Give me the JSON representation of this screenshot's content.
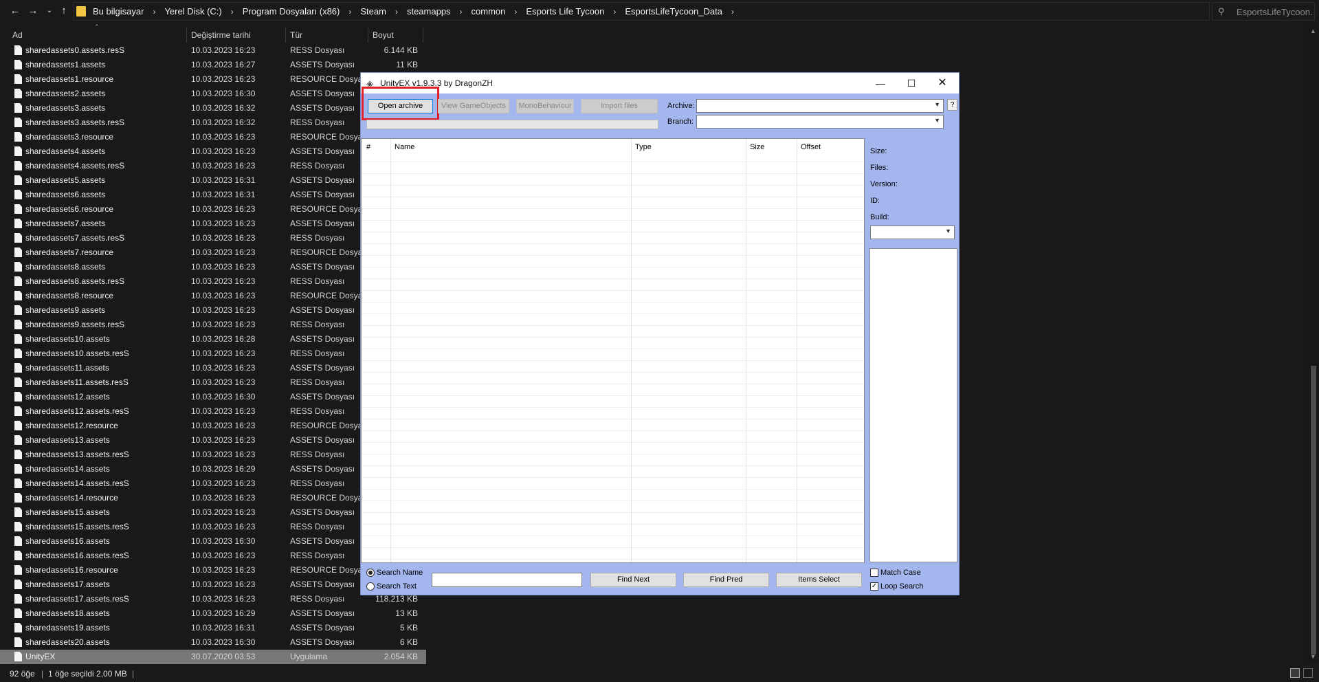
{
  "explorer": {
    "breadcrumbs": [
      "Bu bilgisayar",
      "Yerel Disk (C:)",
      "Program Dosyaları (x86)",
      "Steam",
      "steamapps",
      "common",
      "Esports Life Tycoon",
      "EsportsLifeTycoon_Data"
    ],
    "search_placeholder": "EsportsLifeTycoon...",
    "columns": {
      "name": "Ad",
      "date": "Değiştirme tarihi",
      "type": "Tür",
      "size": "Boyut"
    },
    "files": [
      {
        "name": "sharedassets0.assets.resS",
        "date": "10.03.2023 16:23",
        "type": "RESS Dosyası",
        "size": "6.144 KB"
      },
      {
        "name": "sharedassets1.assets",
        "date": "10.03.2023 16:27",
        "type": "ASSETS Dosyası",
        "size": "11 KB"
      },
      {
        "name": "sharedassets1.resource",
        "date": "10.03.2023 16:23",
        "type": "RESOURCE Dosyası",
        "size": ""
      },
      {
        "name": "sharedassets2.assets",
        "date": "10.03.2023 16:30",
        "type": "ASSETS Dosyası",
        "size": ""
      },
      {
        "name": "sharedassets3.assets",
        "date": "10.03.2023 16:32",
        "type": "ASSETS Dosyası",
        "size": ""
      },
      {
        "name": "sharedassets3.assets.resS",
        "date": "10.03.2023 16:32",
        "type": "RESS Dosyası",
        "size": ""
      },
      {
        "name": "sharedassets3.resource",
        "date": "10.03.2023 16:23",
        "type": "RESOURCE Dosyası",
        "size": ""
      },
      {
        "name": "sharedassets4.assets",
        "date": "10.03.2023 16:23",
        "type": "ASSETS Dosyası",
        "size": ""
      },
      {
        "name": "sharedassets4.assets.resS",
        "date": "10.03.2023 16:23",
        "type": "RESS Dosyası",
        "size": ""
      },
      {
        "name": "sharedassets5.assets",
        "date": "10.03.2023 16:31",
        "type": "ASSETS Dosyası",
        "size": ""
      },
      {
        "name": "sharedassets6.assets",
        "date": "10.03.2023 16:31",
        "type": "ASSETS Dosyası",
        "size": ""
      },
      {
        "name": "sharedassets6.resource",
        "date": "10.03.2023 16:23",
        "type": "RESOURCE Dosyası",
        "size": ""
      },
      {
        "name": "sharedassets7.assets",
        "date": "10.03.2023 16:23",
        "type": "ASSETS Dosyası",
        "size": ""
      },
      {
        "name": "sharedassets7.assets.resS",
        "date": "10.03.2023 16:23",
        "type": "RESS Dosyası",
        "size": ""
      },
      {
        "name": "sharedassets7.resource",
        "date": "10.03.2023 16:23",
        "type": "RESOURCE Dosyası",
        "size": ""
      },
      {
        "name": "sharedassets8.assets",
        "date": "10.03.2023 16:23",
        "type": "ASSETS Dosyası",
        "size": ""
      },
      {
        "name": "sharedassets8.assets.resS",
        "date": "10.03.2023 16:23",
        "type": "RESS Dosyası",
        "size": ""
      },
      {
        "name": "sharedassets8.resource",
        "date": "10.03.2023 16:23",
        "type": "RESOURCE Dosyası",
        "size": ""
      },
      {
        "name": "sharedassets9.assets",
        "date": "10.03.2023 16:23",
        "type": "ASSETS Dosyası",
        "size": ""
      },
      {
        "name": "sharedassets9.assets.resS",
        "date": "10.03.2023 16:23",
        "type": "RESS Dosyası",
        "size": ""
      },
      {
        "name": "sharedassets10.assets",
        "date": "10.03.2023 16:28",
        "type": "ASSETS Dosyası",
        "size": ""
      },
      {
        "name": "sharedassets10.assets.resS",
        "date": "10.03.2023 16:23",
        "type": "RESS Dosyası",
        "size": ""
      },
      {
        "name": "sharedassets11.assets",
        "date": "10.03.2023 16:23",
        "type": "ASSETS Dosyası",
        "size": ""
      },
      {
        "name": "sharedassets11.assets.resS",
        "date": "10.03.2023 16:23",
        "type": "RESS Dosyası",
        "size": ""
      },
      {
        "name": "sharedassets12.assets",
        "date": "10.03.2023 16:30",
        "type": "ASSETS Dosyası",
        "size": ""
      },
      {
        "name": "sharedassets12.assets.resS",
        "date": "10.03.2023 16:23",
        "type": "RESS Dosyası",
        "size": ""
      },
      {
        "name": "sharedassets12.resource",
        "date": "10.03.2023 16:23",
        "type": "RESOURCE Dosyası",
        "size": ""
      },
      {
        "name": "sharedassets13.assets",
        "date": "10.03.2023 16:23",
        "type": "ASSETS Dosyası",
        "size": ""
      },
      {
        "name": "sharedassets13.assets.resS",
        "date": "10.03.2023 16:23",
        "type": "RESS Dosyası",
        "size": ""
      },
      {
        "name": "sharedassets14.assets",
        "date": "10.03.2023 16:29",
        "type": "ASSETS Dosyası",
        "size": ""
      },
      {
        "name": "sharedassets14.assets.resS",
        "date": "10.03.2023 16:23",
        "type": "RESS Dosyası",
        "size": ""
      },
      {
        "name": "sharedassets14.resource",
        "date": "10.03.2023 16:23",
        "type": "RESOURCE Dosyası",
        "size": ""
      },
      {
        "name": "sharedassets15.assets",
        "date": "10.03.2023 16:23",
        "type": "ASSETS Dosyası",
        "size": ""
      },
      {
        "name": "sharedassets15.assets.resS",
        "date": "10.03.2023 16:23",
        "type": "RESS Dosyası",
        "size": ""
      },
      {
        "name": "sharedassets16.assets",
        "date": "10.03.2023 16:30",
        "type": "ASSETS Dosyası",
        "size": ""
      },
      {
        "name": "sharedassets16.assets.resS",
        "date": "10.03.2023 16:23",
        "type": "RESS Dosyası",
        "size": ""
      },
      {
        "name": "sharedassets16.resource",
        "date": "10.03.2023 16:23",
        "type": "RESOURCE Dosyası",
        "size": ""
      },
      {
        "name": "sharedassets17.assets",
        "date": "10.03.2023 16:23",
        "type": "ASSETS Dosyası",
        "size": ""
      },
      {
        "name": "sharedassets17.assets.resS",
        "date": "10.03.2023 16:23",
        "type": "RESS Dosyası",
        "size": "118.213 KB"
      },
      {
        "name": "sharedassets18.assets",
        "date": "10.03.2023 16:29",
        "type": "ASSETS Dosyası",
        "size": "13 KB"
      },
      {
        "name": "sharedassets19.assets",
        "date": "10.03.2023 16:31",
        "type": "ASSETS Dosyası",
        "size": "5 KB"
      },
      {
        "name": "sharedassets20.assets",
        "date": "10.03.2023 16:30",
        "type": "ASSETS Dosyası",
        "size": "6 KB"
      },
      {
        "name": "UnityEX",
        "date": "30.07.2020 03:53",
        "type": "Uygulama",
        "size": "2.054 KB",
        "selected": true
      }
    ],
    "status": {
      "count": "92 öğe",
      "selection": "1 öğe seçildi  2,00 MB"
    }
  },
  "unityex": {
    "title": "UnityEX v1.9.3.3 by DragonZH",
    "buttons": {
      "open_archive": "Open archive",
      "view_gameobjects": "View GameObjects",
      "monobehaviour": "MonoBehaviour",
      "import_files": "Import files",
      "help": "?",
      "find_next": "Find Next",
      "find_pred": "Find Pred",
      "items_select": "Items Select"
    },
    "labels": {
      "archive": "Archive:",
      "branch": "Branch:"
    },
    "grid_columns": {
      "num": "#",
      "name": "Name",
      "type": "Type",
      "size": "Size",
      "offset": "Offset"
    },
    "info": {
      "size": "Size:",
      "files": "Files:",
      "version": "Version:",
      "id": "ID:",
      "build": "Build:"
    },
    "search": {
      "mode_name": "Search Name",
      "mode_text": "Search Text",
      "selected_mode": "name",
      "match_case": "Match Case",
      "loop_search": "Loop Search",
      "match_case_checked": false,
      "loop_search_checked": true
    },
    "highlight_color": "#e21f2a",
    "window_bg": "#a3b6ed"
  }
}
